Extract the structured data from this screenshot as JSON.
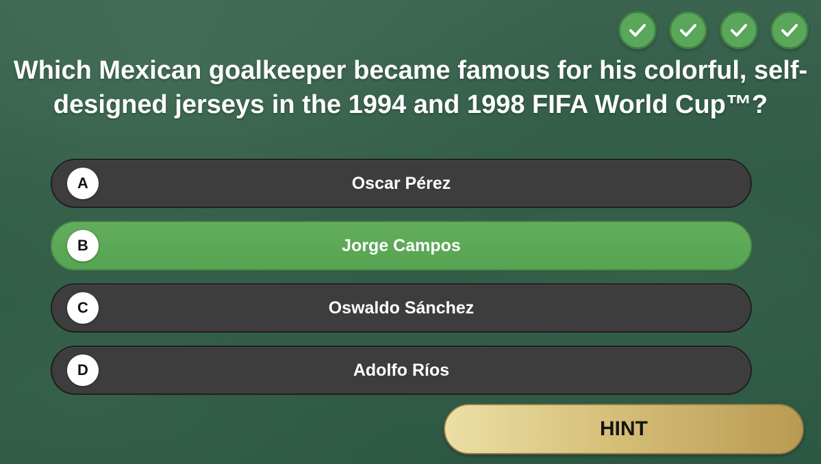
{
  "progress": {
    "completed": 4,
    "icons": [
      "check-icon",
      "check-icon",
      "check-icon",
      "check-icon"
    ]
  },
  "question": {
    "line1": "Which Mexican goalkeeper became famous for his colorful, self-",
    "line2": "designed jerseys in the 1994 and 1998 FIFA World Cup™?"
  },
  "answers": [
    {
      "letter": "A",
      "text": "Oscar Pérez"
    },
    {
      "letter": "B",
      "text": "Jorge Campos"
    },
    {
      "letter": "C",
      "text": "Oswaldo Sánchez"
    },
    {
      "letter": "D",
      "text": "Adolfo Ríos"
    }
  ],
  "selected_answer": "B",
  "hint": {
    "label": "HINT"
  },
  "colors": {
    "correct": "#5aa65a",
    "answer_bg": "#3d3d3d",
    "hint_gold": "#d6c07a",
    "background": "#2f5a45"
  }
}
